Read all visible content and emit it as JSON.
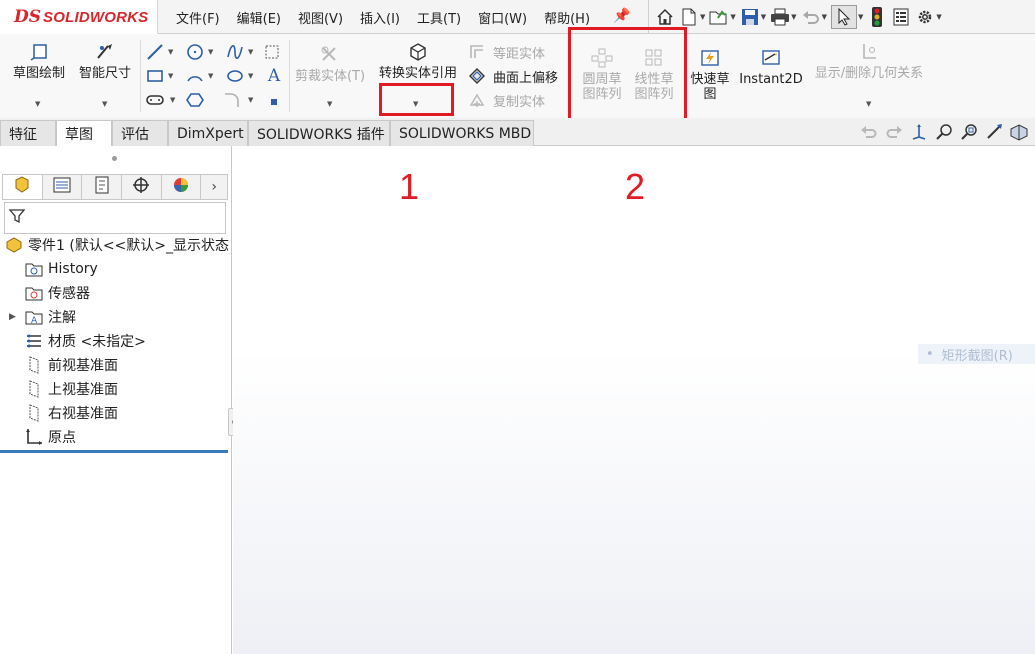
{
  "app": {
    "logo_prefix": "DS",
    "logo_name": "SOLIDWORKS"
  },
  "menu": {
    "items": [
      "文件(F)",
      "编辑(E)",
      "视图(V)",
      "插入(I)",
      "工具(T)",
      "窗口(W)",
      "帮助(H)"
    ]
  },
  "ribbon": {
    "sketch": "草图绘制",
    "smart_dim": "智能尺寸",
    "trim": "剪裁实体(T)",
    "convert": "转换实体引用",
    "offset": "等距实体",
    "surface_offset": "曲面上偏移",
    "copy": "复制实体",
    "circular_pattern_1": "圆周草",
    "circular_pattern_2": "图阵列",
    "linear_pattern_1": "线性草",
    "linear_pattern_2": "图阵列",
    "rapid_sketch_1": "快速草",
    "rapid_sketch_2": "图",
    "instant2d": "Instant2D",
    "relations": "显示/删除几何关系"
  },
  "annotations": {
    "label_1": "1",
    "label_2": "2",
    "color": "#e01b24"
  },
  "tabs": [
    "特征",
    "草图",
    "评估",
    "DimXpert",
    "SOLIDWORKS 插件",
    "SOLIDWORKS MBD"
  ],
  "tree": {
    "root": "零件1 (默认<<默认>_显示状态",
    "items": [
      "History",
      "传感器",
      "注解",
      "材质 <未指定>",
      "前视基准面",
      "上视基准面",
      "右视基准面",
      "原点"
    ]
  },
  "graphics": {
    "hint": "矩形截图(R)"
  },
  "colors": {
    "brand": "#d8262a",
    "accent": "#3a7bbf"
  }
}
